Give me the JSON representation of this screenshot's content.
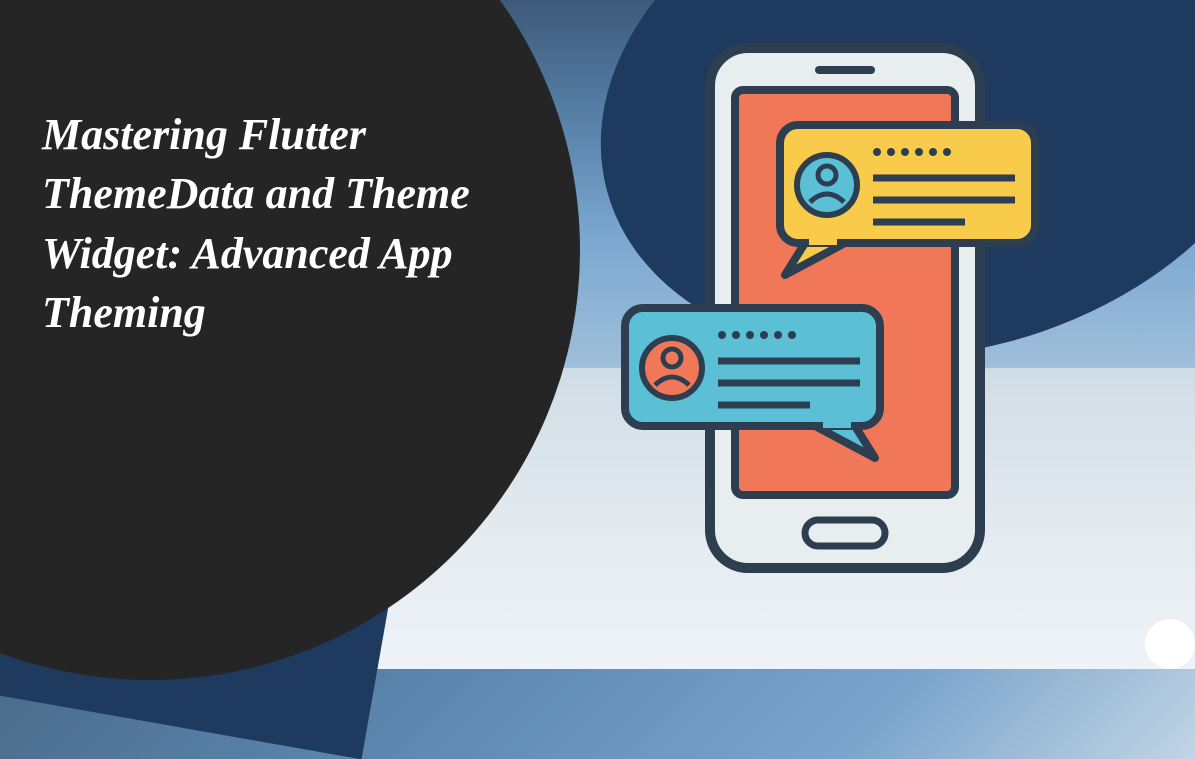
{
  "title": "Mastering Flutter ThemeData and Theme Widget: Advanced App Theming",
  "colors": {
    "phoneFrame": "#2c3e50",
    "phoneScreen": "#f07858",
    "bubbleYellow": "#f8cb4a",
    "bubbleBlue": "#5bbfd6",
    "darkCircle": "#252525"
  }
}
